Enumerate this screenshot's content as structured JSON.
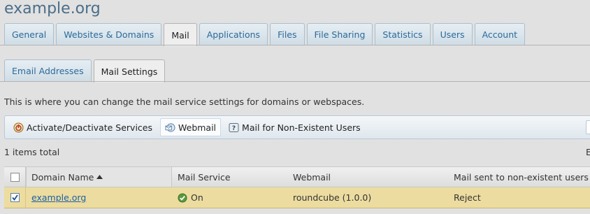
{
  "page": {
    "title": "example.org"
  },
  "main_tabs": [
    {
      "label": "General",
      "active": false
    },
    {
      "label": "Websites & Domains",
      "active": false
    },
    {
      "label": "Mail",
      "active": true
    },
    {
      "label": "Applications",
      "active": false
    },
    {
      "label": "Files",
      "active": false
    },
    {
      "label": "File Sharing",
      "active": false
    },
    {
      "label": "Statistics",
      "active": false
    },
    {
      "label": "Users",
      "active": false
    },
    {
      "label": "Account",
      "active": false
    }
  ],
  "sub_tabs": [
    {
      "label": "Email Addresses",
      "active": false
    },
    {
      "label": "Mail Settings",
      "active": true
    }
  ],
  "description": "This is where you can change the mail service settings for domains or webspaces.",
  "toolbar": {
    "activate_label": "Activate/Deactivate Services",
    "webmail_label": "Webmail",
    "nonexistent_label": "Mail for Non-Existent Users"
  },
  "items_total": "1 items total",
  "right_truncated_letter": "E",
  "table": {
    "headers": {
      "domain": "Domain Name",
      "mail_service": "Mail Service",
      "webmail": "Webmail",
      "nonexistent": "Mail sent to non-existent users"
    },
    "rows": [
      {
        "domain": "example.org",
        "mail_service": "On",
        "webmail": "roundcube (1.0.0)",
        "nonexistent": "Reject",
        "selected": true
      }
    ]
  },
  "colors": {
    "accent": "#2b6a9a",
    "selected_row": "#ecdca0",
    "title": "#4b6e8a"
  }
}
